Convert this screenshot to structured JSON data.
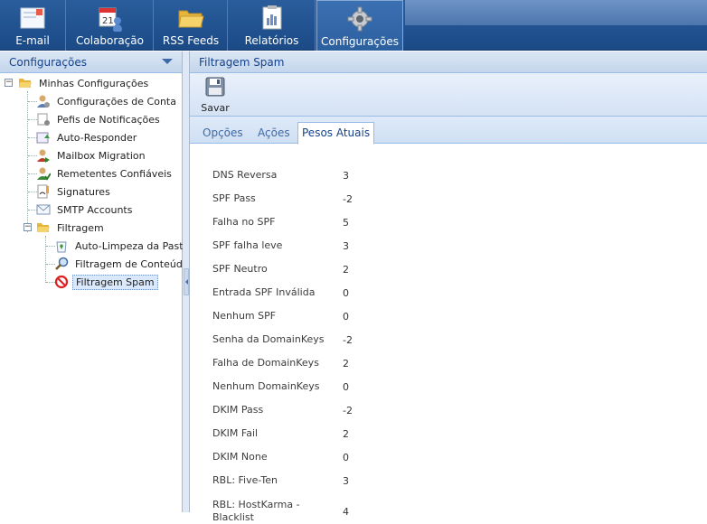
{
  "nav": {
    "items": [
      {
        "label": "E-mail",
        "icon": "mail-icon"
      },
      {
        "label": "Colaboração",
        "icon": "calendar-icon"
      },
      {
        "label": "RSS Feeds",
        "icon": "folder-icon"
      },
      {
        "label": "Relatórios",
        "icon": "report-icon"
      },
      {
        "label": "Configurações",
        "icon": "gear-icon"
      }
    ]
  },
  "left": {
    "title": "Configurações",
    "tree": {
      "root": "Minhas Configurações",
      "items": [
        "Configurações de Conta",
        "Pefis de Notificações",
        "Auto-Responder",
        "Mailbox Migration",
        "Remetentes Confiáveis",
        "Signatures",
        "SMTP Accounts"
      ],
      "filter_group": "Filtragem",
      "filter_items": [
        "Auto-Limpeza da Pasta",
        "Filtragem de Conteúdo",
        "Filtragem Spam"
      ]
    }
  },
  "right": {
    "title": "Filtragem Spam",
    "save_label": "Savar",
    "tabs": [
      "Opções",
      "Ações",
      "Pesos Atuais"
    ],
    "weights": [
      {
        "name": "DNS Reversa",
        "value": "3"
      },
      {
        "name": "SPF Pass",
        "value": "-2"
      },
      {
        "name": "Falha no SPF",
        "value": "5"
      },
      {
        "name": "SPF falha leve",
        "value": "3"
      },
      {
        "name": "SPF Neutro",
        "value": "2"
      },
      {
        "name": "Entrada SPF Inválida",
        "value": "0"
      },
      {
        "name": "Nenhum SPF",
        "value": "0"
      },
      {
        "name": "Senha da DomainKeys",
        "value": "-2"
      },
      {
        "name": "Falha de DomainKeys",
        "value": "2"
      },
      {
        "name": "Nenhum DomainKeys",
        "value": "0"
      },
      {
        "name": "DKIM Pass",
        "value": "-2"
      },
      {
        "name": "DKIM Fail",
        "value": "2"
      },
      {
        "name": "DKIM None",
        "value": "0"
      },
      {
        "name": "RBL: Five-Ten",
        "value": "3"
      },
      {
        "name": "RBL: HostKarma - Blacklist",
        "value": "4"
      }
    ]
  }
}
